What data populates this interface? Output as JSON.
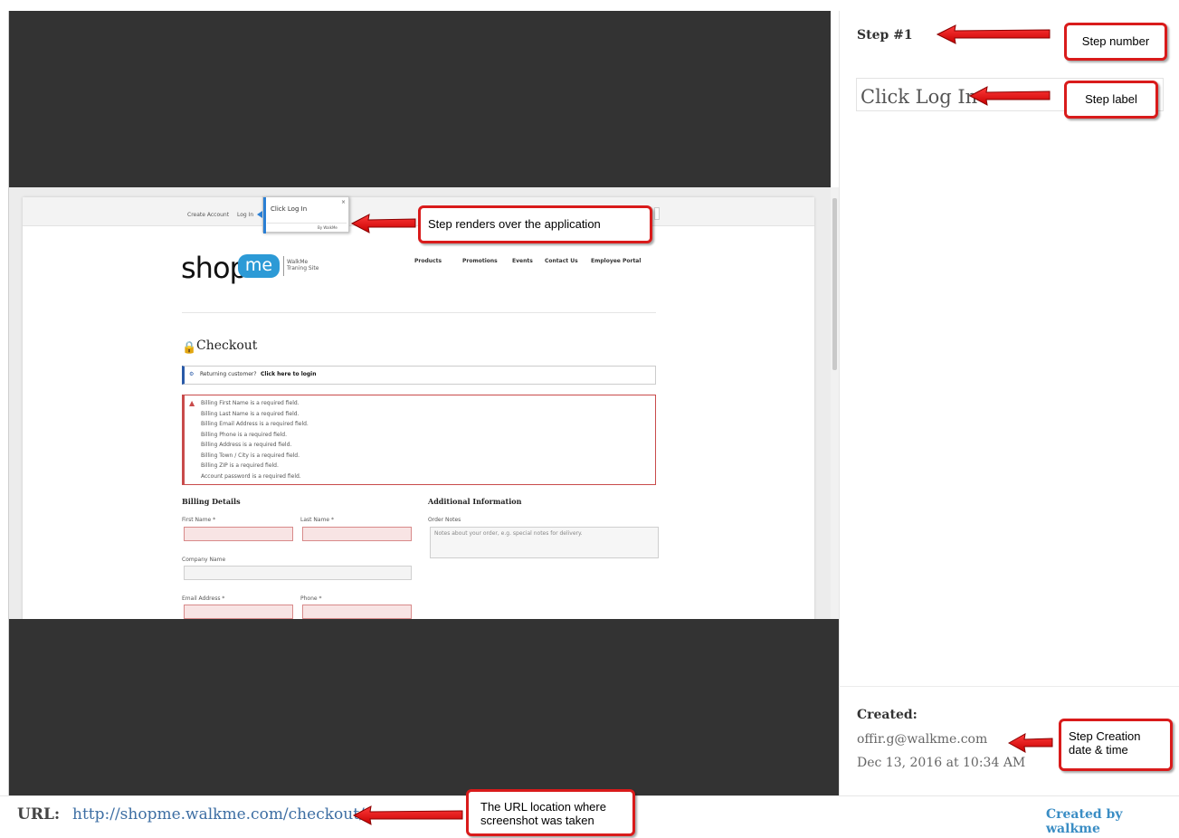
{
  "step": {
    "number": "Step #1",
    "label": "Click Log In"
  },
  "created": {
    "heading": "Created:",
    "email": "offir.g@walkme.com",
    "datetime": "Dec 13, 2016 at 10:34 AM"
  },
  "url": {
    "label": "URL:",
    "value": "http://shopme.walkme.com/checkout/"
  },
  "footer": {
    "created_by": "Created by walkme"
  },
  "callouts": {
    "step_number": "Step number",
    "step_label": "Step label",
    "renders": "Step renders over the application",
    "creation": "Step Creation date & time",
    "url_location": "The URL location where screenshot was taken"
  },
  "app": {
    "topnav": [
      "Create Account",
      "Log In"
    ],
    "tooltip": {
      "text": "Click Log In",
      "brand": "By WalkMe",
      "close": "×"
    },
    "logo": {
      "word": "shop",
      "badge": "me",
      "tag1": "WalkMe",
      "tag2": "Traning Site"
    },
    "menu": [
      "Products",
      "Promotions",
      "Events",
      "Contact Us",
      "Employee Portal"
    ],
    "checkout_title": "Checkout",
    "returning": {
      "prefix": "Returning customer?",
      "link": "Click here to login"
    },
    "errors": [
      "Billing First Name is a required field.",
      "Billing Last Name is a required field.",
      "Billing Email Address is a required field.",
      "Billing Phone is a required field.",
      "Billing Address is a required field.",
      "Billing Town / City is a required field.",
      "Billing ZIP is a required field.",
      "Account password is a required field."
    ],
    "billing_title": "Billing Details",
    "additional_title": "Additional Information",
    "labels": {
      "first": "First Name *",
      "last": "Last Name *",
      "company": "Company Name",
      "email": "Email Address *",
      "phone": "Phone *",
      "notes": "Order Notes"
    },
    "notes_placeholder": "Notes about your order, e.g. special notes for delivery."
  }
}
